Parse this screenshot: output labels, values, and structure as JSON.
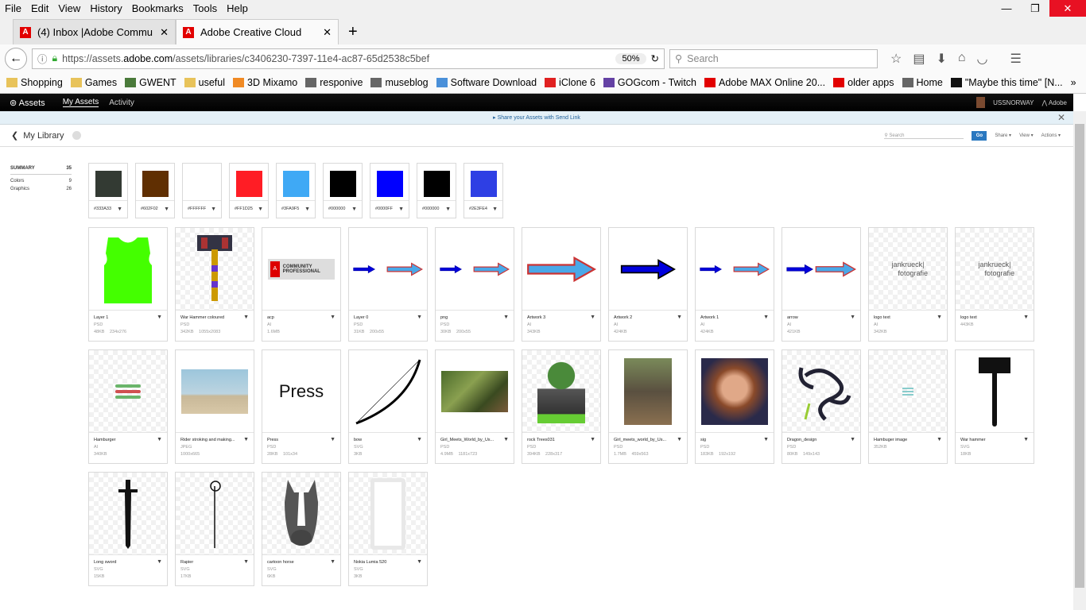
{
  "menu": [
    "File",
    "Edit",
    "View",
    "History",
    "Bookmarks",
    "Tools",
    "Help"
  ],
  "tabs": [
    {
      "title": "(4) Inbox |Adobe Commu..."
    },
    {
      "title": "Adobe Creative Cloud"
    }
  ],
  "url": {
    "prefix": "https://assets.",
    "domain": "adobe.com",
    "rest": "/assets/libraries/c3406230-7397-11e4-ac87-65d2538c5bef",
    "zoom": "50%"
  },
  "search_placeholder": "Search",
  "bookmarks": [
    "Shopping",
    "Games",
    "GWENT",
    "useful",
    "3D Mixamo",
    "responive",
    "museblog",
    "Software Download",
    "iClone 6",
    "GOGcom - Twitch",
    "Adobe MAX Online 20...",
    "older apps",
    "Home",
    "\"Maybe this time\" [N..."
  ],
  "app": {
    "logo": "Assets",
    "nav": [
      "My Assets",
      "Activity"
    ],
    "user": "USSNORWAY",
    "brand": "Adobe"
  },
  "banner": "▸ Share your Assets with Send Link",
  "library": {
    "title": "My Library",
    "search_placeholder": "Search",
    "go": "Go",
    "share": "Share ▾",
    "view": "View ▾",
    "actions": "Actions ▾"
  },
  "summary": [
    {
      "label": "SUMMARY",
      "count": "35"
    },
    {
      "label": "Colors",
      "count": "9"
    },
    {
      "label": "Graphics",
      "count": "26"
    }
  ],
  "colors": [
    "#333A33",
    "#602F02",
    "#FFFFFF",
    "#FF1D25",
    "#3FA9F5",
    "#000000",
    "#0000FF",
    "#000000",
    "#2E3FE4"
  ],
  "assets": [
    {
      "name": "Layer 1",
      "type": "PSD",
      "size": "48KB",
      "dims": "234x276",
      "thumb": "shirt"
    },
    {
      "name": "War Hammer coloured",
      "type": "PSD",
      "size": "342KB",
      "dims": "1055x2083",
      "thumb": "hammercol"
    },
    {
      "name": "acp",
      "type": "AI",
      "size": "1.6MB",
      "dims": "",
      "thumb": "acp"
    },
    {
      "name": "Layer 0",
      "type": "PSD",
      "size": "31KB",
      "dims": "200x55",
      "thumb": "arrows"
    },
    {
      "name": "png",
      "type": "PSD",
      "size": "30KB",
      "dims": "200x55",
      "thumb": "arrows"
    },
    {
      "name": "Artwork 3",
      "type": "AI",
      "size": "343KB",
      "dims": "",
      "thumb": "bigarrow-light"
    },
    {
      "name": "Artwork 2",
      "type": "AI",
      "size": "424KB",
      "dims": "",
      "thumb": "bigarrow-dark"
    },
    {
      "name": "Artwork 1",
      "type": "AI",
      "size": "424KB",
      "dims": "",
      "thumb": "arrows"
    },
    {
      "name": "arrow",
      "type": "AI",
      "size": "421KB",
      "dims": "",
      "thumb": "arrows2"
    },
    {
      "name": "logo text",
      "type": "AI",
      "size": "342KB",
      "dims": "",
      "thumb": "logotext"
    },
    {
      "name": "logo text",
      "type": "",
      "size": "443KB",
      "dims": "",
      "thumb": "logotext"
    },
    {
      "name": "Hamburger",
      "type": "AI",
      "size": "340KB",
      "dims": "",
      "thumb": "hamburger"
    },
    {
      "name": "Rider stroking and making...",
      "type": "JPEG",
      "size": "1000x665",
      "dims": "",
      "thumb": "photo-beach"
    },
    {
      "name": "Press",
      "type": "PSD",
      "size": "28KB",
      "dims": "101x34",
      "thumb": "press"
    },
    {
      "name": "bow",
      "type": "SVG",
      "size": "3KB",
      "dims": "",
      "thumb": "bow"
    },
    {
      "name": "Girl_Meets_World_by_Us...",
      "type": "PSD",
      "size": "4.9MB",
      "dims": "1181x723",
      "thumb": "photo-forest"
    },
    {
      "name": "rock Trees031",
      "type": "PSD",
      "size": "394KB",
      "dims": "228x317",
      "thumb": "rock"
    },
    {
      "name": "Girl_meets_world_by_Us...",
      "type": "PSD",
      "size": "1.7MB",
      "dims": "459x563",
      "thumb": "photo-girl"
    },
    {
      "name": "sig",
      "type": "PSD",
      "size": "183KB",
      "dims": "192x192",
      "thumb": "portrait"
    },
    {
      "name": "Dragon_design",
      "type": "PSD",
      "size": "80KB",
      "dims": "149x143",
      "thumb": "dragon"
    },
    {
      "name": "Hambuger image",
      "type": "",
      "size": "352KB",
      "dims": "",
      "thumb": "hamburger-small"
    },
    {
      "name": "War hammer",
      "type": "SVG",
      "size": "18KB",
      "dims": "",
      "thumb": "hammer"
    },
    {
      "name": "Long sword",
      "type": "SVG",
      "size": "15KB",
      "dims": "",
      "thumb": "sword"
    },
    {
      "name": "Rapier",
      "type": "SVG",
      "size": "17KB",
      "dims": "",
      "thumb": "rapier"
    },
    {
      "name": "cartoon horse",
      "type": "SVG",
      "size": "6KB",
      "dims": "",
      "thumb": "horse"
    },
    {
      "name": "Nokia Lumia 520",
      "type": "SVG",
      "size": "3KB",
      "dims": "",
      "thumb": "phone"
    }
  ],
  "acp_text": "COMMUNITY PROFESSIONAL",
  "press_text": "Press",
  "logo_text": "jankrueck| fotografie"
}
